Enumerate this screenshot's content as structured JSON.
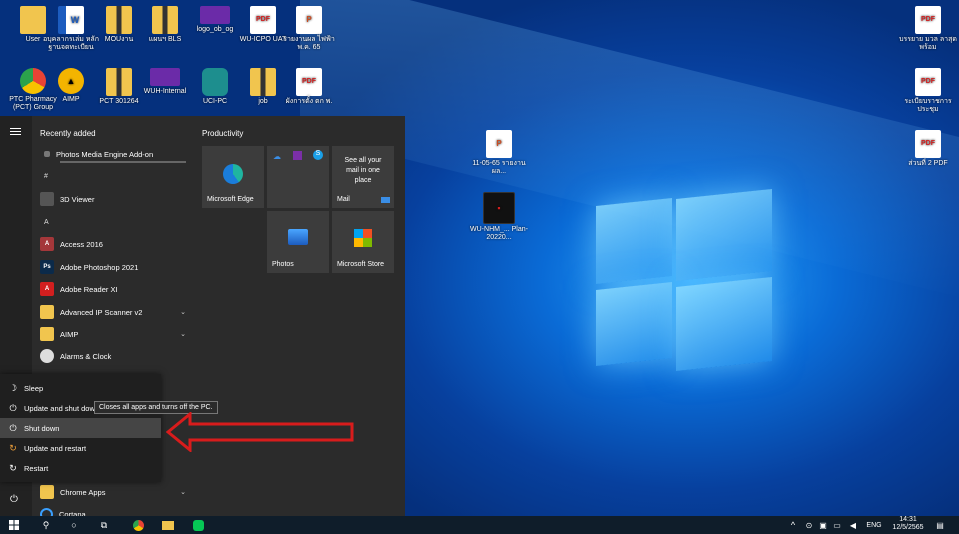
{
  "desktop": {
    "icons_left": [
      {
        "label": "User",
        "type": "user"
      },
      {
        "label": "อบุคลากรเล่ม หลักฐานจดทะเบียน",
        "type": "word"
      },
      {
        "label": "MOUงาน",
        "type": "zipf"
      },
      {
        "label": "แผนฯ BLS",
        "type": "zipf"
      },
      {
        "label": "logo_ob_og",
        "type": "purple"
      },
      {
        "label": "WU-ICPO UAT",
        "type": "pdf"
      },
      {
        "label": "รายงานผล ไฟฟ้า พ.ค. 65",
        "type": "ppt"
      },
      {
        "label": "PTC Pharmacy (PCT) Group",
        "type": "chrome"
      },
      {
        "label": "AIMP",
        "type": "aimp"
      },
      {
        "label": "PCT 301264",
        "type": "zipf"
      },
      {
        "label": "WUH-Internal",
        "type": "purple"
      },
      {
        "label": "UCI-PC",
        "type": "ucp"
      },
      {
        "label": "job",
        "type": "zipf"
      },
      {
        "label": "ผังการตั้ง ตก พ.",
        "type": "pdf"
      }
    ],
    "icons_right": [
      {
        "label": "บรรยาย มวล ลาสุดพร้อม",
        "type": "pdf"
      },
      {
        "label": "ระเบียบราชการ ประชุม",
        "type": "pdf"
      },
      {
        "label": "ส่วนที่ 2 PDF",
        "type": "pdf"
      }
    ],
    "icons_mid": [
      {
        "label": "11-05-65 รายงานผล...",
        "type": "ppt"
      },
      {
        "label": "WU-NHM_... Plan-20220...",
        "type": "dark"
      }
    ]
  },
  "start_menu": {
    "recently_added_label": "Recently added",
    "productivity_label": "Productivity",
    "recent_app": "Photos Media Engine Add-on",
    "letters": [
      "#",
      "A"
    ],
    "apps": [
      {
        "label": "3D Viewer",
        "icon": "cube-icon",
        "color": "#555"
      },
      {
        "label": "Access 2016",
        "icon": "access-icon",
        "color": "#a4373a",
        "glyph": "A"
      },
      {
        "label": "Adobe Photoshop 2021",
        "icon": "photoshop-icon",
        "color": "#0b2a4a",
        "glyph": "Ps"
      },
      {
        "label": "Adobe Reader XI",
        "icon": "acrobat-icon",
        "color": "#d21f1f",
        "glyph": "A"
      },
      {
        "label": "Advanced IP Scanner v2",
        "icon": "folder-icon",
        "color": "#f1c54e",
        "glyph": ""
      },
      {
        "label": "AIMP",
        "icon": "folder-icon",
        "color": "#f1c54e",
        "glyph": ""
      },
      {
        "label": "Alarms & Clock",
        "icon": "clock-icon",
        "color": "#ddd",
        "glyph": ""
      }
    ],
    "bottom_apps": [
      {
        "label": "Chrome Apps"
      },
      {
        "label": "Cortana"
      }
    ],
    "tiles": [
      {
        "label": "Microsoft Edge"
      },
      {
        "label": ""
      },
      {
        "label": "Mail",
        "text": "See all your mail in one place"
      },
      {
        "label": "Photos"
      },
      {
        "label": "Microsoft Store"
      }
    ]
  },
  "power_menu": {
    "items": [
      "Sleep",
      "Update and shut down",
      "Shut down",
      "Update and restart",
      "Restart"
    ],
    "tooltip": "Closes all apps and turns off the PC."
  },
  "taskbar": {
    "lang": "ENG",
    "time": "14:31",
    "date": "12/5/2565"
  },
  "colors": {
    "annotation_arrow": "#d81c1c",
    "highlight": "#454545"
  }
}
